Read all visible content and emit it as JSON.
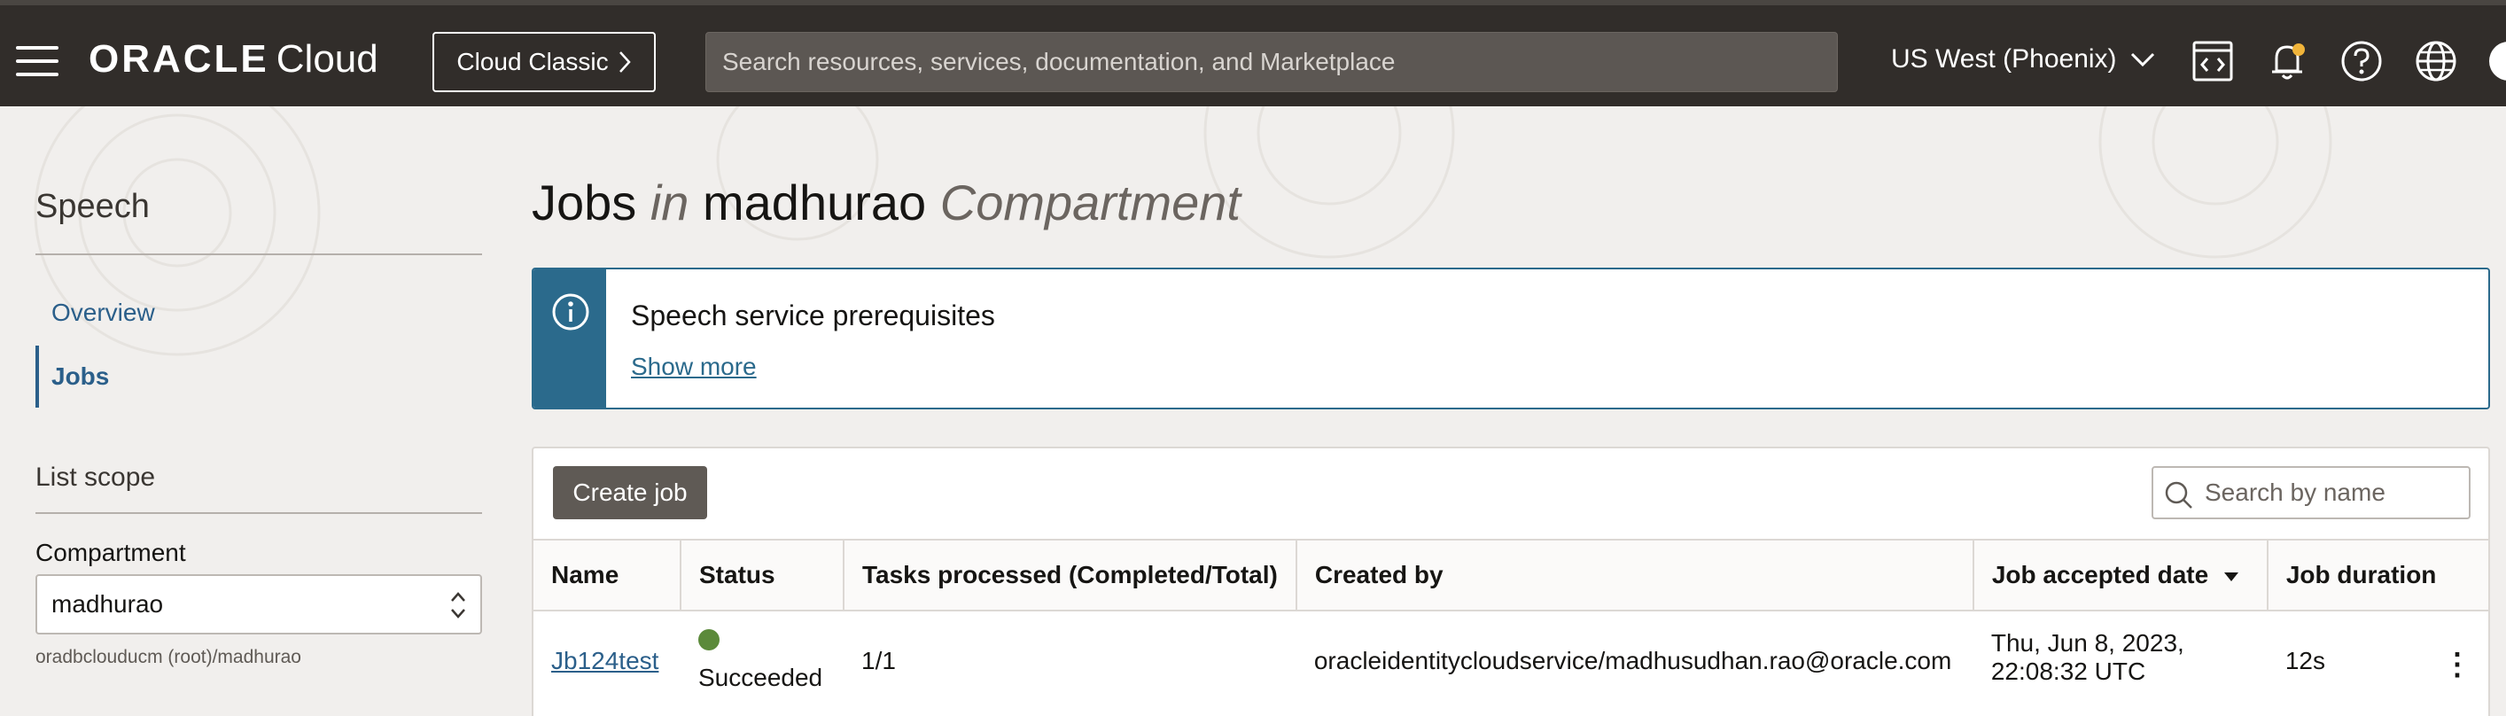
{
  "header": {
    "brand": "ORACLE",
    "product": "Cloud",
    "classic_button": "Cloud Classic",
    "search_placeholder": "Search resources, services, documentation, and Marketplace",
    "region": "US West (Phoenix)"
  },
  "sidebar": {
    "title": "Speech",
    "items": [
      {
        "label": "Overview"
      },
      {
        "label": "Jobs"
      }
    ],
    "scope_title": "List scope",
    "compartment_label": "Compartment",
    "compartment_value": "madhurao",
    "compartment_path": "oradbclouducm (root)/madhurao"
  },
  "main": {
    "title_part1": "Jobs",
    "title_in": "in",
    "title_part2": "madhurao",
    "title_part3": "Compartment",
    "info": {
      "title": "Speech service prerequisites",
      "link": "Show more"
    },
    "create_button": "Create job",
    "search_placeholder": "Search by name",
    "table": {
      "columns": [
        "Name",
        "Status",
        "Tasks processed (Completed/Total)",
        "Created by",
        "Job accepted date",
        "Job duration"
      ],
      "rows": [
        {
          "name": "Jb124test",
          "status": "Succeeded",
          "tasks": "1/1",
          "created_by": "oracleidentitycloudservice/madhusudhan.rao@oracle.com",
          "accepted_date_line1": "Thu, Jun 8, 2023,",
          "accepted_date_line2": "22:08:32 UTC",
          "duration": "12s"
        }
      ]
    }
  },
  "colors": {
    "header_bg": "#312d2a",
    "accent": "#2b6a8c",
    "success": "#5b8a3a"
  }
}
